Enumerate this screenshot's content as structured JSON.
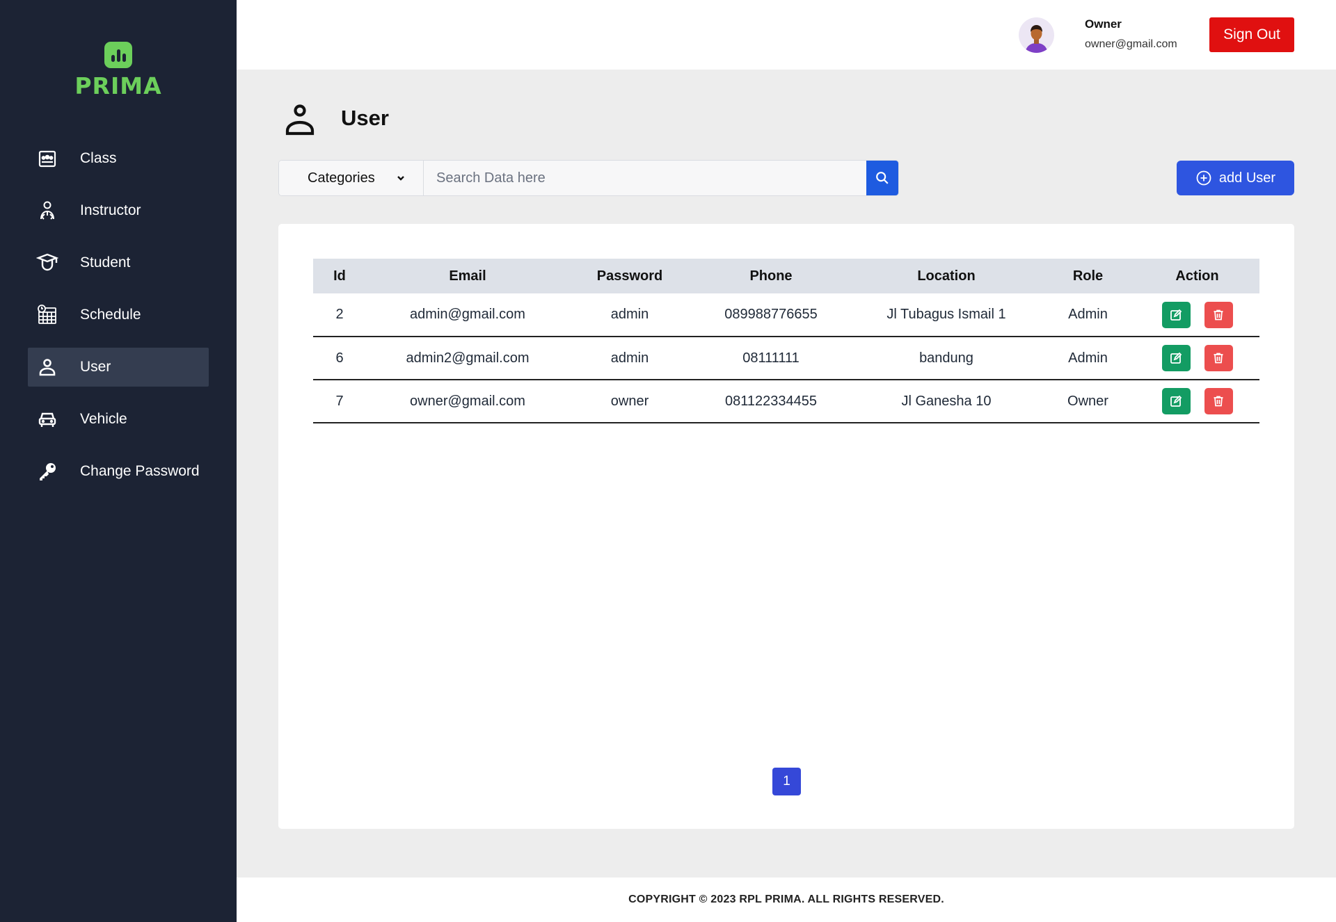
{
  "app": {
    "logo_text": "PRIMA",
    "accent_color": "#6ccf5b"
  },
  "sidebar": {
    "items": [
      {
        "label": "Class",
        "icon": "class-icon",
        "active": false
      },
      {
        "label": "Instructor",
        "icon": "instructor-icon",
        "active": false
      },
      {
        "label": "Student",
        "icon": "student-icon",
        "active": false
      },
      {
        "label": "Schedule",
        "icon": "schedule-icon",
        "active": false
      },
      {
        "label": "User",
        "icon": "user-icon",
        "active": true
      },
      {
        "label": "Vehicle",
        "icon": "vehicle-icon",
        "active": false
      },
      {
        "label": "Change Password",
        "icon": "key-icon",
        "active": false
      }
    ]
  },
  "header": {
    "user_name": "Owner",
    "user_email": "owner@gmail.com",
    "signout_label": "Sign Out"
  },
  "page": {
    "title": "User"
  },
  "search": {
    "category_label": "Categories",
    "placeholder": "Search Data here",
    "value": ""
  },
  "add_button_label": "add User",
  "table": {
    "columns": [
      "Id",
      "Email",
      "Password",
      "Phone",
      "Location",
      "Role",
      "Action"
    ],
    "rows": [
      {
        "id": "2",
        "email": "admin@gmail.com",
        "password": "admin",
        "phone": "089988776655",
        "location": "Jl Tubagus Ismail 1",
        "role": "Admin"
      },
      {
        "id": "6",
        "email": "admin2@gmail.com",
        "password": "admin",
        "phone": "08111111",
        "location": "bandung",
        "role": "Admin"
      },
      {
        "id": "7",
        "email": "owner@gmail.com",
        "password": "owner",
        "phone": "081122334455",
        "location": "Jl Ganesha 10",
        "role": "Owner"
      }
    ]
  },
  "pagination": {
    "current_page": "1"
  },
  "footer": {
    "text": "COPYRIGHT © 2023 RPL PRIMA. ALL RIGHTS RESERVED."
  }
}
